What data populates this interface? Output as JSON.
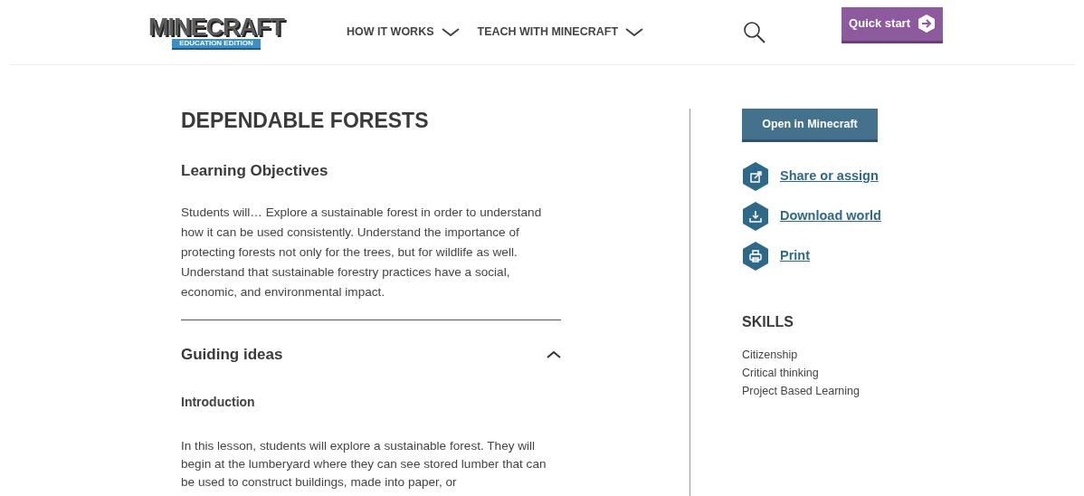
{
  "header": {
    "logo": {
      "title": "MINECRAFT",
      "subtitle": "EDUCATION EDITION"
    },
    "nav": [
      {
        "label": "HOW IT WORKS",
        "expanded": false
      },
      {
        "label": "TEACH WITH MINECRAFT",
        "expanded": false
      }
    ],
    "quick_start": "Quick start"
  },
  "lesson": {
    "title": "DEPENDABLE FORESTS",
    "objectives": {
      "heading": "Learning Objectives",
      "text": "Students will… Explore a sustainable forest in order to understand how it can be used consistently. Understand the importance of protecting forests not only for the trees, but for wildlife as well. Understand that sustainable forestry practices have a social, economic, and environmental impact."
    },
    "guiding": {
      "heading": "Guiding ideas",
      "expanded": true,
      "subheading": "Introduction",
      "text": "In this lesson, students will explore a sustainable forest. They will begin at the lumberyard where they can see stored lumber that can be used to construct buildings, made into paper, or"
    }
  },
  "sidebar": {
    "open_button": "Open in Minecraft",
    "actions": [
      {
        "kind": "share",
        "label": "Share or assign"
      },
      {
        "kind": "download",
        "label": "Download world"
      },
      {
        "kind": "print",
        "label": "Print"
      }
    ],
    "skills": {
      "heading": "SKILLS",
      "items": [
        "Citizenship",
        "Critical thinking",
        "Project Based Learning"
      ]
    }
  }
}
